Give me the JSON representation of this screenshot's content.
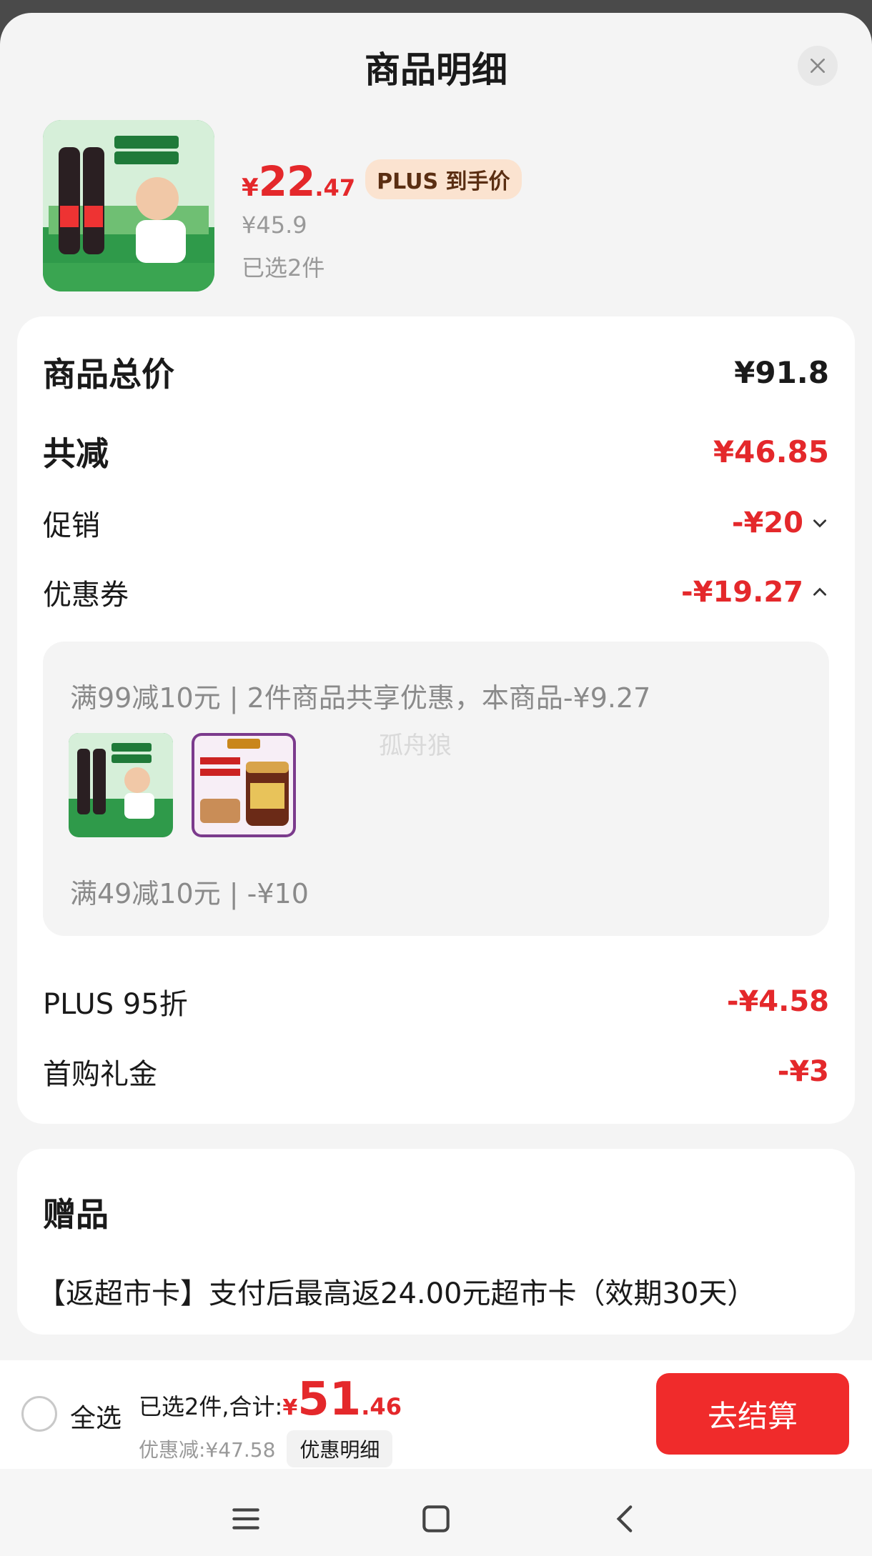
{
  "sheet": {
    "title": "商品明细"
  },
  "product": {
    "price_symbol": "¥",
    "price_integer": "22",
    "price_decimal": ".47",
    "plus_badge": "PLUS 到手价",
    "original_price": "¥45.9",
    "selected_count": "已选2件"
  },
  "details": {
    "total_label": "商品总价",
    "total_value": "¥91.8",
    "reduced_label": "共减",
    "reduced_value": "¥46.85",
    "promotion_label": "促销",
    "promotion_value": "-¥20",
    "coupon_label": "优惠券",
    "coupon_value": "-¥19.27",
    "coupons": [
      {
        "text": "满99减10元 | 2件商品共享优惠，本商品-¥9.27"
      },
      {
        "text": "满49减10元 | -¥10"
      }
    ],
    "watermark": "孤舟狼",
    "plus_label": "PLUS 95折",
    "plus_value": "-¥4.58",
    "first_buy_label": "首购礼金",
    "first_buy_value": "-¥3"
  },
  "gift": {
    "title": "赠品",
    "text": "【返超市卡】支付后最高返24.00元超市卡（效期30天）"
  },
  "bottom_bar": {
    "select_all": "全选",
    "summary_prefix": "已选2件,合计:",
    "total_symbol": "¥",
    "total_integer": "51",
    "total_decimal": ".46",
    "discount_text": "优惠减:¥47.58",
    "discount_detail": "优惠明细",
    "checkout": "去结算"
  },
  "colors": {
    "accent_red": "#e4282b",
    "checkout_red": "#f02b2b",
    "plus_badge_bg": "#fbe3d0"
  },
  "icons": [
    "close-icon",
    "chevron-down-icon",
    "chevron-up-icon",
    "menu-icon",
    "home-square-icon",
    "back-icon"
  ]
}
